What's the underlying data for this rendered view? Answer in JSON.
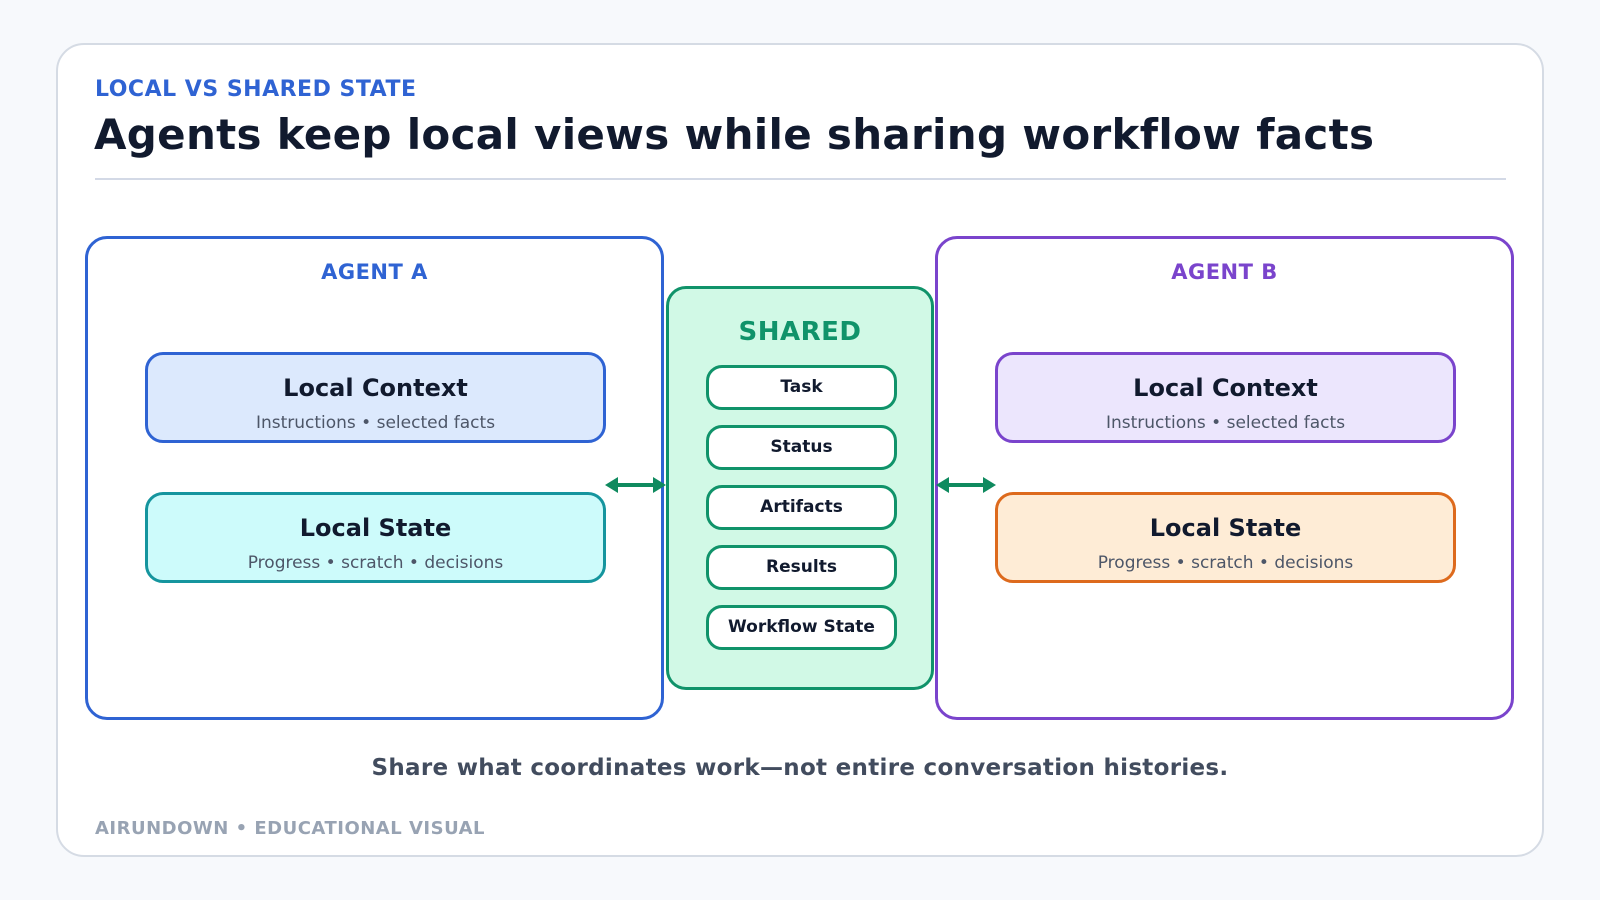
{
  "header": {
    "eyebrow": "LOCAL VS SHARED STATE",
    "title": "Agents keep local views while sharing workflow facts"
  },
  "agent_a": {
    "label": "AGENT A",
    "context_title": "Local Context",
    "context_sub": "Instructions • selected facts",
    "state_title": "Local State",
    "state_sub": "Progress • scratch • decisions"
  },
  "shared": {
    "label": "SHARED",
    "items": [
      "Task",
      "Status",
      "Artifacts",
      "Results",
      "Workflow State"
    ]
  },
  "agent_b": {
    "label": "AGENT B",
    "context_title": "Local Context",
    "context_sub": "Instructions • selected facts",
    "state_title": "Local State",
    "state_sub": "Progress • scratch • decisions"
  },
  "caption": "Share what coordinates work—not entire conversation histories.",
  "footer": "AIRUNDOWN • EDUCATIONAL VISUAL",
  "colors": {
    "agent_a": "#2f63d3",
    "agent_b": "#7a44cc",
    "shared": "#10936a",
    "agent_a_state": "#15959e",
    "agent_b_state": "#dd6a1d"
  }
}
